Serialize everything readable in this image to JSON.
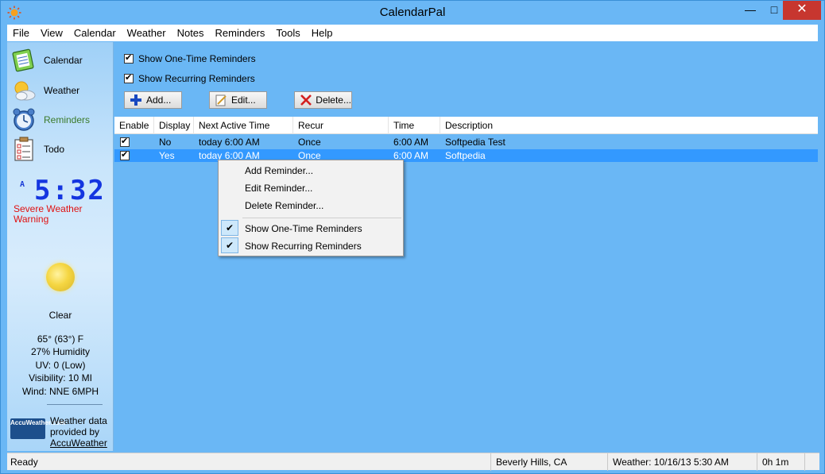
{
  "window": {
    "title": "CalendarPal",
    "min_glyph": "—",
    "max_glyph": "□",
    "close_glyph": "✕"
  },
  "menu": [
    "File",
    "View",
    "Calendar",
    "Weather",
    "Notes",
    "Reminders",
    "Tools",
    "Help"
  ],
  "sidebar": {
    "nav": [
      {
        "label": "Calendar",
        "icon": "calendar-icon"
      },
      {
        "label": "Weather",
        "icon": "weather-icon"
      },
      {
        "label": "Reminders",
        "icon": "alarm-clock-icon"
      },
      {
        "label": "Todo",
        "icon": "todo-list-icon"
      }
    ],
    "clock": {
      "ampm": "A",
      "time": "5:32"
    },
    "warning": "Severe Weather Warning",
    "condition": "Clear",
    "temperature": "65° (63°) F",
    "humidity": "27% Humidity",
    "uv": "UV: 0 (Low)",
    "visibility": "Visibility: 10 MI",
    "wind": "Wind: NNE 6MPH",
    "accu_logo": "AccuWeather.com",
    "accu_line1": "Weather data",
    "accu_line2": "provided by",
    "accu_link": "AccuWeather"
  },
  "main": {
    "show_one_time": "Show One-Time Reminders",
    "show_recurring": "Show Recurring Reminders",
    "buttons": {
      "add": "Add...",
      "edit": "Edit...",
      "delete": "Delete..."
    },
    "columns": [
      "Enable",
      "Display",
      "Next Active Time",
      "Recur",
      "Time",
      "Description"
    ],
    "rows": [
      {
        "enable": true,
        "display": "No",
        "next": "today 6:00 AM",
        "recur": "Once",
        "time": "6:00 AM",
        "description": "Softpedia Test"
      },
      {
        "enable": true,
        "display": "Yes",
        "next": "today 6:00 AM",
        "recur": "Once",
        "time": "6:00 AM",
        "description": "Softpedia"
      }
    ]
  },
  "context_menu": {
    "add": "Add Reminder...",
    "edit": "Edit Reminder...",
    "delete": "Delete Reminder...",
    "show_one_time": "Show One-Time Reminders",
    "show_recurring": "Show Recurring Reminders",
    "check_glyph": "✔"
  },
  "status": {
    "state": "Ready",
    "location": "Beverly Hills, CA",
    "weather": "Weather: 10/16/13 5:30 AM",
    "elapsed": "0h 1m"
  }
}
